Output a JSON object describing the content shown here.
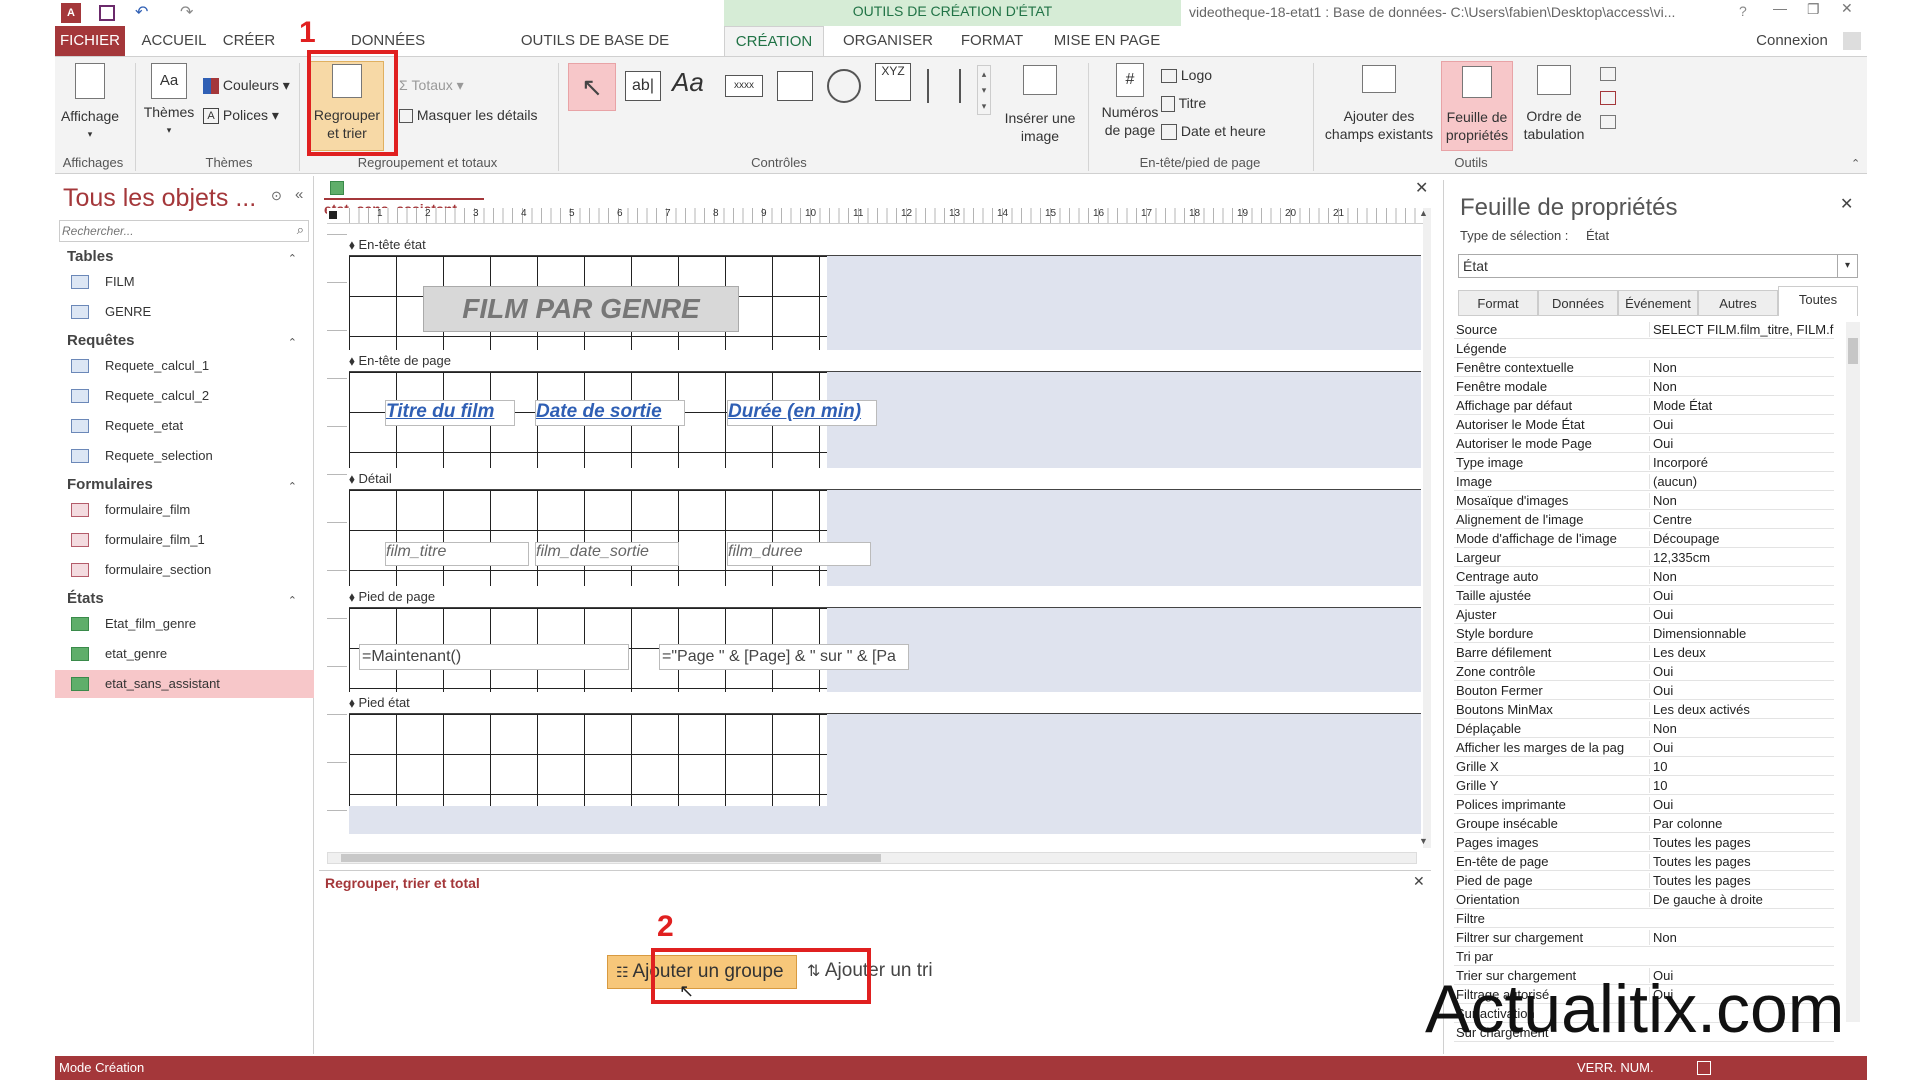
{
  "window": {
    "context_band": "OUTILS DE CRÉATION D'ÉTAT",
    "title": "videotheque-18-etat1 : Base de données- C:\\Users\\fabien\\Desktop\\access\\vi...",
    "signin": "Connexion",
    "help": "?"
  },
  "tabs": [
    "FICHIER",
    "ACCUEIL",
    "CRÉER",
    "DONNÉES EXTERNES",
    "OUTILS DE BASE DE DONNÉES",
    "CRÉATION",
    "ORGANISER",
    "FORMAT",
    "MISE EN PAGE"
  ],
  "active_tab": "CRÉATION",
  "ribbon": {
    "groups": {
      "affichages": "Affichages",
      "themes": "Thèmes",
      "regroupement": "Regroupement et totaux",
      "controles": "Contrôles",
      "entete_pied": "En-tête/pied de page",
      "outils": "Outils"
    },
    "affichage": "Affichage",
    "themes": "Thèmes",
    "couleurs": "Couleurs",
    "polices": "Polices",
    "regrouper": "Regrouper et trier",
    "totaux": "Totaux",
    "masquer": "Masquer les détails",
    "inserer_image": "Insérer une image",
    "numeros_page": "Numéros de page",
    "logo": "Logo",
    "titre": "Titre",
    "date_heure": "Date et heure",
    "ajouter_champs": "Ajouter des champs existants",
    "feuille_proprietes": "Feuille de propriétés",
    "ordre_tabulation": "Ordre de tabulation",
    "control_glyphs": {
      "textbox": "ab|",
      "label": "Aa",
      "xyz": "XYZ"
    }
  },
  "nav": {
    "title": "Tous les objets ...",
    "search_placeholder": "Rechercher...",
    "sections": [
      {
        "name": "Tables",
        "items": [
          "FILM",
          "GENRE"
        ]
      },
      {
        "name": "Requêtes",
        "items": [
          "Requete_calcul_1",
          "Requete_calcul_2",
          "Requete_etat",
          "Requete_selection"
        ]
      },
      {
        "name": "Formulaires",
        "items": [
          "formulaire_film",
          "formulaire_film_1",
          "formulaire_section"
        ]
      },
      {
        "name": "États",
        "items": [
          "Etat_film_genre",
          "etat_genre",
          "etat_sans_assistant"
        ]
      }
    ],
    "selected": "etat_sans_assistant"
  },
  "document": {
    "tab_label": "etat_sans_assistant",
    "ruler_numbers": [
      "1",
      "2",
      "3",
      "4",
      "5",
      "6",
      "7",
      "8",
      "9",
      "10",
      "11",
      "12",
      "13",
      "14",
      "15",
      "16",
      "17",
      "18",
      "19",
      "20",
      "21"
    ],
    "sections": {
      "entete_etat": "En-tête état",
      "entete_page": "En-tête de page",
      "detail": "Détail",
      "pied_page": "Pied de page",
      "pied_etat": "Pied état"
    },
    "report_title": "FILM PAR GENRE",
    "headers": [
      "Titre du film",
      "Date de sortie",
      "Durée (en min)"
    ],
    "fields": [
      "film_titre",
      "film_date_sortie",
      "film_duree"
    ],
    "footer_now": "=Maintenant()",
    "footer_page": "=\"Page \" & [Page] & \" sur \" & [Pa"
  },
  "group_pane": {
    "title": "Regrouper, trier et total",
    "add_group": "Ajouter un groupe",
    "add_sort": "Ajouter un tri"
  },
  "properties": {
    "title": "Feuille de propriétés",
    "selection_type_label": "Type de sélection :",
    "selection_type_value": "État",
    "object_select": "État",
    "tabs": [
      "Format",
      "Données",
      "Événement",
      "Autres",
      "Toutes"
    ],
    "active_tab": "Toutes",
    "rows": [
      [
        "Source",
        "SELECT FILM.film_titre, FILM.film_dat"
      ],
      [
        "Légende",
        ""
      ],
      [
        "Fenêtre contextuelle",
        "Non"
      ],
      [
        "Fenêtre modale",
        "Non"
      ],
      [
        "Affichage par défaut",
        "Mode État"
      ],
      [
        "Autoriser le Mode État",
        "Oui"
      ],
      [
        "Autoriser le mode Page",
        "Oui"
      ],
      [
        "Type image",
        "Incorporé"
      ],
      [
        "Image",
        "(aucun)"
      ],
      [
        "Mosaïque d'images",
        "Non"
      ],
      [
        "Alignement de l'image",
        "Centre"
      ],
      [
        "Mode d'affichage de l'image",
        "Découpage"
      ],
      [
        "Largeur",
        "12,335cm"
      ],
      [
        "Centrage auto",
        "Non"
      ],
      [
        "Taille ajustée",
        "Oui"
      ],
      [
        "Ajuster",
        "Oui"
      ],
      [
        "Style bordure",
        "Dimensionnable"
      ],
      [
        "Barre défilement",
        "Les deux"
      ],
      [
        "Zone contrôle",
        "Oui"
      ],
      [
        "Bouton Fermer",
        "Oui"
      ],
      [
        "Boutons MinMax",
        "Les deux activés"
      ],
      [
        "Déplaçable",
        "Non"
      ],
      [
        "Afficher les marges de la pag",
        "Oui"
      ],
      [
        "Grille X",
        "10"
      ],
      [
        "Grille Y",
        "10"
      ],
      [
        "Polices imprimante",
        "Oui"
      ],
      [
        "Groupe insécable",
        "Par colonne"
      ],
      [
        "Pages images",
        "Toutes les pages"
      ],
      [
        "En-tête de page",
        "Toutes les pages"
      ],
      [
        "Pied de page",
        "Toutes les pages"
      ],
      [
        "Orientation",
        "De gauche à droite"
      ],
      [
        "Filtre",
        ""
      ],
      [
        "Filtrer sur chargement",
        "Non"
      ],
      [
        "Tri par",
        ""
      ],
      [
        "Trier sur chargement",
        "Oui"
      ],
      [
        "Filtrage autorisé",
        "Oui"
      ],
      [
        "Sur activation",
        ""
      ],
      [
        "Sur chargement",
        ""
      ]
    ]
  },
  "status": {
    "mode": "Mode Création",
    "numlock": "VERR. NUM."
  },
  "annotations": {
    "step1": "1",
    "step2": "2"
  },
  "watermark": "Actualitix.com",
  "colors": {
    "accent": "#a4373a",
    "green": "#217346",
    "highlight": "#f7c7c9"
  }
}
